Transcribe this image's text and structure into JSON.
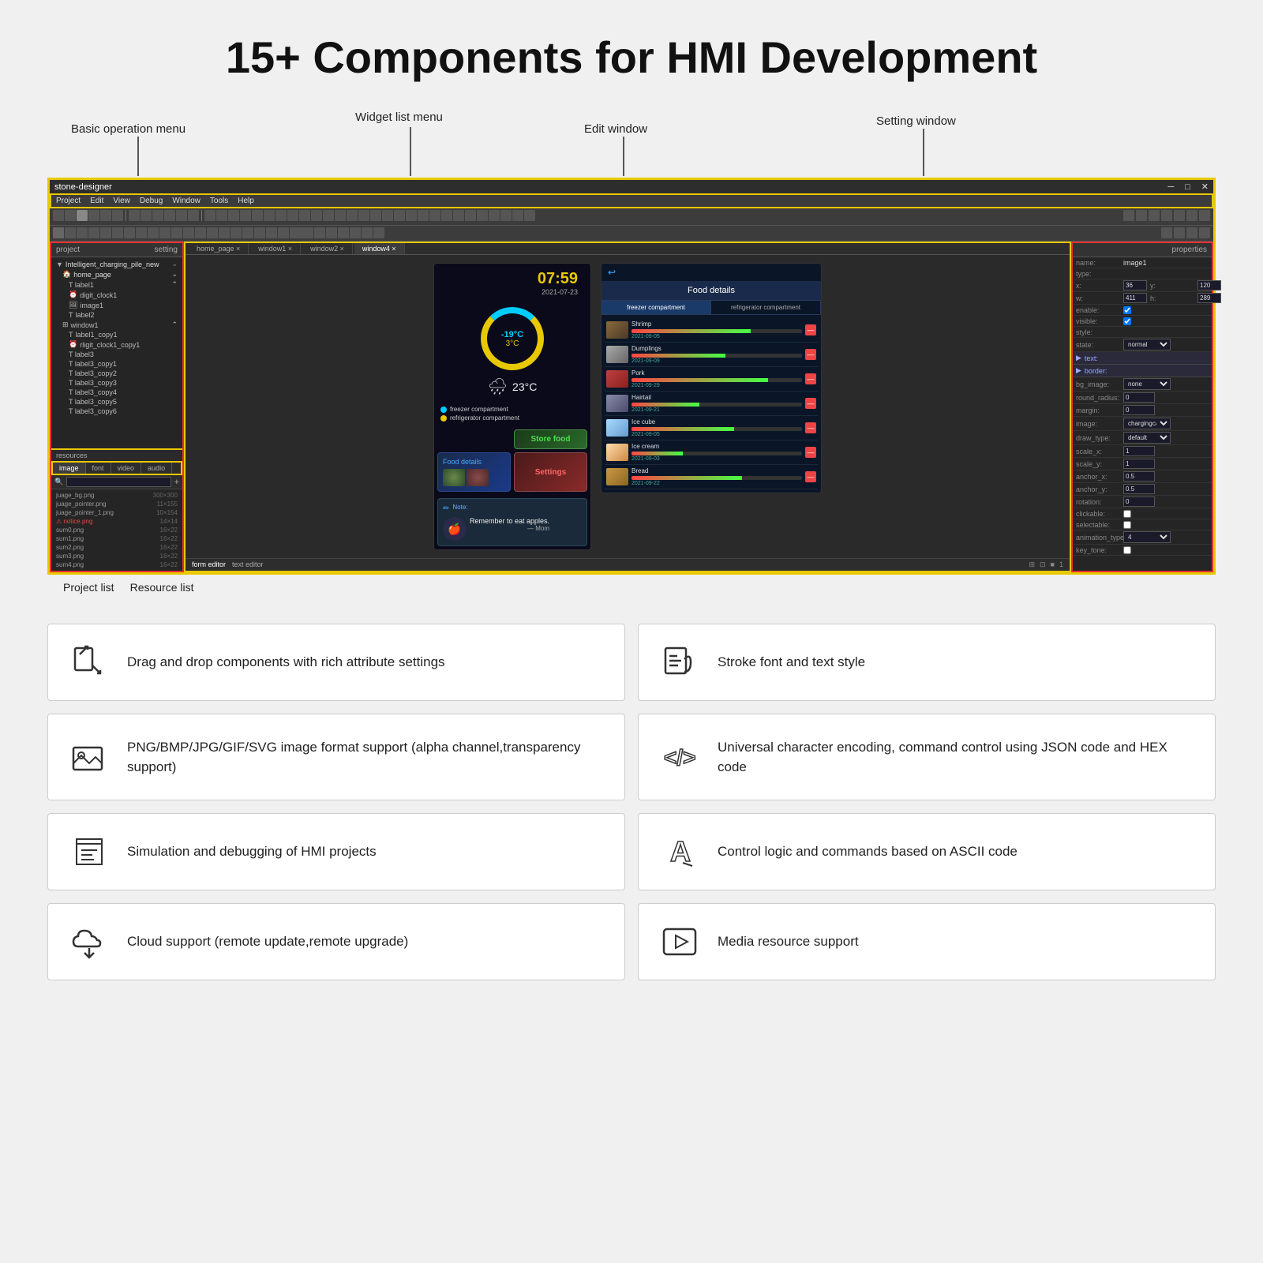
{
  "page": {
    "title": "15+ Components for HMI Development",
    "annotation_labels": {
      "basic_op": "Basic operation menu",
      "widget_list": "Widget list menu",
      "edit_window": "Edit window",
      "setting_window": "Setting window",
      "project_list": "Project list",
      "resource_list": "Resource list"
    }
  },
  "ide": {
    "title": "stone-designer",
    "menu": [
      "Project",
      "Edit",
      "View",
      "Debug",
      "Window",
      "Tools",
      "Help"
    ],
    "tabs": [
      "home_page ×",
      "window1 ×",
      "window2 ×",
      "window4 ×"
    ],
    "panel_left": {
      "header_left": "project",
      "header_right": "setting",
      "tree_items": [
        "Intelligent_charging_pile_new",
        "home_page",
        "label1",
        "digit_clock1",
        "image1",
        "label2",
        "window1",
        "label1_copy1",
        "rligit_clock1_copy1",
        "label3",
        "label3_copy1",
        "label3_copy2",
        "label3_copy3",
        "label3_copy4",
        "label3_copy5",
        "label3_copy6"
      ],
      "resource_section": "resources",
      "resource_tabs": [
        "image",
        "font",
        "video",
        "audio"
      ],
      "resource_items": [
        {
          "name": "juage_bg.png",
          "size": "300 × 300"
        },
        {
          "name": "juage_pointer.png",
          "size": "11 × 155"
        },
        {
          "name": "juage_pointer_1.png",
          "size": "10 × 154"
        },
        {
          "name": "notice.png",
          "size": "14 × 14"
        },
        {
          "name": "sum0.png",
          "size": "16 × 22"
        },
        {
          "name": "sum1.png",
          "size": "16 × 22"
        },
        {
          "name": "sum2.png",
          "size": "16 × 22"
        },
        {
          "name": "sum3.png",
          "size": "16 × 22"
        },
        {
          "name": "sum4.png",
          "size": "16 × 22"
        }
      ]
    },
    "phone_ui": {
      "header": "Food details",
      "tabs": [
        "freezer compartment",
        "refrigerator compartment"
      ],
      "food_items": [
        {
          "name": "Shrimp",
          "date": "2021-09-05",
          "bar_pct": 70
        },
        {
          "name": "Dumplings",
          "date": "2021-09-09",
          "bar_pct": 55
        },
        {
          "name": "Pork",
          "date": "2021-09-29",
          "bar_pct": 80
        },
        {
          "name": "Hairtail",
          "date": "2021-09-21",
          "bar_pct": 40
        },
        {
          "name": "Ice cube",
          "date": "2021-09-05",
          "bar_pct": 60
        },
        {
          "name": "Ice cream",
          "date": "2021-09-03",
          "bar_pct": 30
        },
        {
          "name": "Bread",
          "date": "2021-09-22",
          "bar_pct": 65
        }
      ]
    },
    "dashboard": {
      "temperature_inner": "-19°C",
      "temperature_outer": "3°C",
      "time": "07:59",
      "date": "2021-07-23",
      "weather_temp": "23°C",
      "legend": [
        {
          "color": "#00ccff",
          "label": "freezer compartment"
        },
        {
          "color": "#e8c800",
          "label": "refrigerator compartment"
        }
      ],
      "btn_store_food": "Store food",
      "btn_food_details": "Food details",
      "btn_settings": "Settings",
      "note_title": "Note:",
      "note_text": "Remember to eat apples.",
      "note_author": "— Mom"
    },
    "properties": {
      "title": "properties",
      "rows": [
        {
          "label": "name:",
          "value": "image1"
        },
        {
          "label": "type:",
          "value": ""
        },
        {
          "label": "x:",
          "value": "36",
          "y_label": "y:",
          "y_value": "120"
        },
        {
          "label": "w:",
          "value": "411",
          "h_label": "h:",
          "h_value": "289"
        },
        {
          "label": "enable:",
          "value": "checked"
        },
        {
          "label": "visible:",
          "value": "checked"
        },
        {
          "label": "style:",
          "value": ""
        },
        {
          "label": "state:",
          "value": "normal"
        },
        {
          "label": "text:",
          "value": ""
        },
        {
          "label": "border:",
          "value": ""
        },
        {
          "label": "bg_image:",
          "value": "none"
        },
        {
          "label": "round_radius:",
          "value": "0"
        },
        {
          "label": "margin:",
          "value": "0"
        },
        {
          "label": "image:",
          "value": "chargingcar"
        },
        {
          "label": "draw_type:",
          "value": "default"
        },
        {
          "label": "scale_x:",
          "value": "1"
        },
        {
          "label": "scale_y:",
          "value": "1"
        },
        {
          "label": "anchor_x:",
          "value": "0.5"
        },
        {
          "label": "anchor_y:",
          "value": "0.5"
        },
        {
          "label": "rotation:",
          "value": "0"
        },
        {
          "label": "clickable:",
          "value": "unchecked"
        },
        {
          "label": "selectable:",
          "value": "unchecked"
        },
        {
          "label": "animation_type:",
          "value": "4"
        },
        {
          "label": "key_tone:",
          "value": "unchecked"
        }
      ]
    },
    "canvas_bottom": [
      "form editor",
      "text editor"
    ]
  },
  "features": [
    {
      "id": "drag-drop",
      "icon": "drag-drop-icon",
      "text": "Drag and drop components with rich attribute settings"
    },
    {
      "id": "stroke-font",
      "icon": "stroke-font-icon",
      "text": "Stroke font and text style"
    },
    {
      "id": "image-format",
      "icon": "image-format-icon",
      "text": "PNG/BMP/JPG/GIF/SVG image format support (alpha channel,transparency support)"
    },
    {
      "id": "unicode",
      "icon": "unicode-icon",
      "text": "Universal character encoding, command control using JSON code and HEX code"
    },
    {
      "id": "simulation",
      "icon": "simulation-icon",
      "text": "Simulation and debugging of HMI projects"
    },
    {
      "id": "ascii",
      "icon": "ascii-icon",
      "text": "Control logic and commands based on ASCII code"
    },
    {
      "id": "cloud",
      "icon": "cloud-icon",
      "text": "Cloud support (remote update,remote upgrade)"
    },
    {
      "id": "media",
      "icon": "media-icon",
      "text": "Media resource support"
    }
  ]
}
